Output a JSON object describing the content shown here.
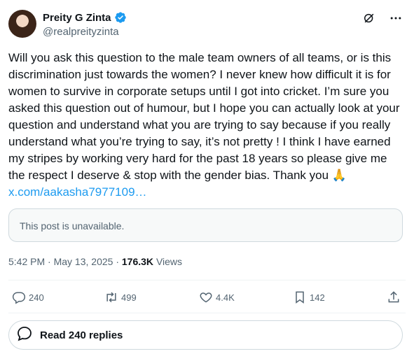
{
  "author": {
    "display_name": "Preity G Zinta",
    "handle": "@realpreityzinta",
    "verified_icon": "verified-badge-icon"
  },
  "tweet": {
    "text": "Will you ask this question to the male team owners of all  teams, or is this  discrimination just towards the women?  I never knew how difficult it is for women to survive in corporate setups until I got into cricket. I’m sure you asked this question out of humour, but I hope you can actually look at your question and understand what you are trying to say because if you really understand what you’re trying to say, it’s not pretty ! I think I have earned my stripes  by working very hard for the past 18 years so please give me the respect I deserve & stop with the gender bias. Thank you 🙏",
    "link": "x.com/aakasha7977109…",
    "quote_unavailable": "This post is unavailable.",
    "time": "5:42 PM",
    "date": "May 13, 2025",
    "views_count": "176.3K",
    "views_label": "Views"
  },
  "actions": {
    "replies": "240",
    "reposts": "499",
    "likes": "4.4K",
    "bookmarks": "142"
  },
  "read_replies_label": "Read 240 replies",
  "colors": {
    "accent": "#1d9bf0",
    "text": "#0f1419",
    "secondary": "#536471"
  }
}
